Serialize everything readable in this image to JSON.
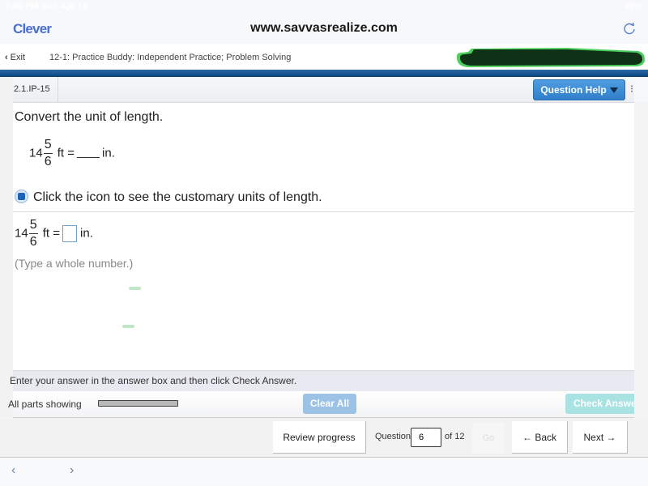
{
  "status_bar": {
    "time": "7:40 PM  Sun Apr 18",
    "battery": "46%"
  },
  "browser": {
    "brand": "Clever",
    "url": "www.savvasrealize.com",
    "reload_icon": "reload-icon"
  },
  "app_bar": {
    "exit_label": "Exit",
    "breadcrumb": "12-1: Practice Buddy: Independent Practice; Problem Solving"
  },
  "question_header": {
    "question_id": "2.1.IP-15",
    "help_label": "Question Help",
    "more_glyph": "⁝"
  },
  "question": {
    "instruction": "Convert the unit of length.",
    "equation": {
      "whole": "14",
      "numerator": "5",
      "denominator": "6",
      "from_unit": "ft =",
      "to_unit": "in."
    },
    "hint_text": "Click the icon to see the customary units of length.",
    "answer": {
      "whole": "14",
      "numerator": "5",
      "denominator": "6",
      "from_unit": "ft =",
      "to_unit": "in.",
      "value": ""
    },
    "type_hint": "(Type a whole number.)"
  },
  "instruction_bar": {
    "text": "Enter your answer in the answer box and then click Check Answer."
  },
  "parts_bar": {
    "label": "All parts showing",
    "progress": 1.0,
    "clear_all_label": "Clear All",
    "check_answer_label": "Check Answer"
  },
  "nav": {
    "review_label": "Review progress",
    "question_label": "Question",
    "question_value": "6",
    "of_label": "of 12",
    "go_label": "Go",
    "back_label": "← Back",
    "next_label": "Next →"
  },
  "bottom_bar": {
    "back_glyph": "‹",
    "forward_glyph": "›"
  },
  "colors": {
    "accent_blue": "#2f7fcb",
    "brand_blue": "#4a6fd4",
    "header_bar": "#0b4a85",
    "check_answer": "#a8e2e2",
    "clear_all": "#9cc3e6"
  }
}
